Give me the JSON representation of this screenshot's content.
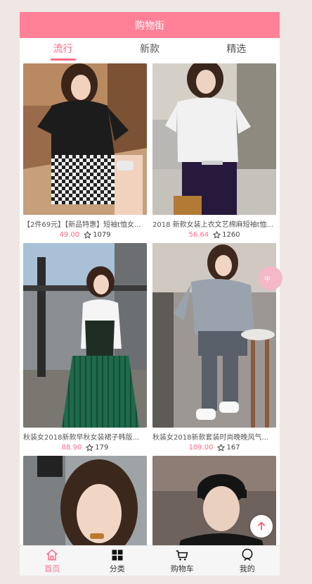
{
  "header": {
    "title": "购物街"
  },
  "tabs": [
    {
      "label": "流行"
    },
    {
      "label": "新款"
    },
    {
      "label": "精选"
    }
  ],
  "products": [
    {
      "title": "【2件69元】【新品特惠】短袖t恤女...",
      "price": "49.00",
      "favs": "1079"
    },
    {
      "title": "2018 新款女装上衣文艺棉麻短袖t恤...",
      "price": "56.64",
      "favs": "1260"
    },
    {
      "title": "秋装女2018新款早秋女装裙子韩版...",
      "price": "88.90",
      "favs": "179"
    },
    {
      "title": "秋装女2018新款套装时尚晚晚风气...",
      "price": "109.00",
      "favs": "167"
    },
    {
      "title": "",
      "price": "",
      "favs": ""
    },
    {
      "title": "",
      "price": "",
      "favs": ""
    }
  ],
  "float_badge": {
    "text": "中"
  },
  "bottom_nav": [
    {
      "label": "首页",
      "icon": "home-icon"
    },
    {
      "label": "分类",
      "icon": "category-icon"
    },
    {
      "label": "购物车",
      "icon": "cart-icon"
    },
    {
      "label": "我的",
      "icon": "profile-icon"
    }
  ],
  "colors": {
    "accent": "#ff6a88",
    "header": "#ff8198"
  }
}
